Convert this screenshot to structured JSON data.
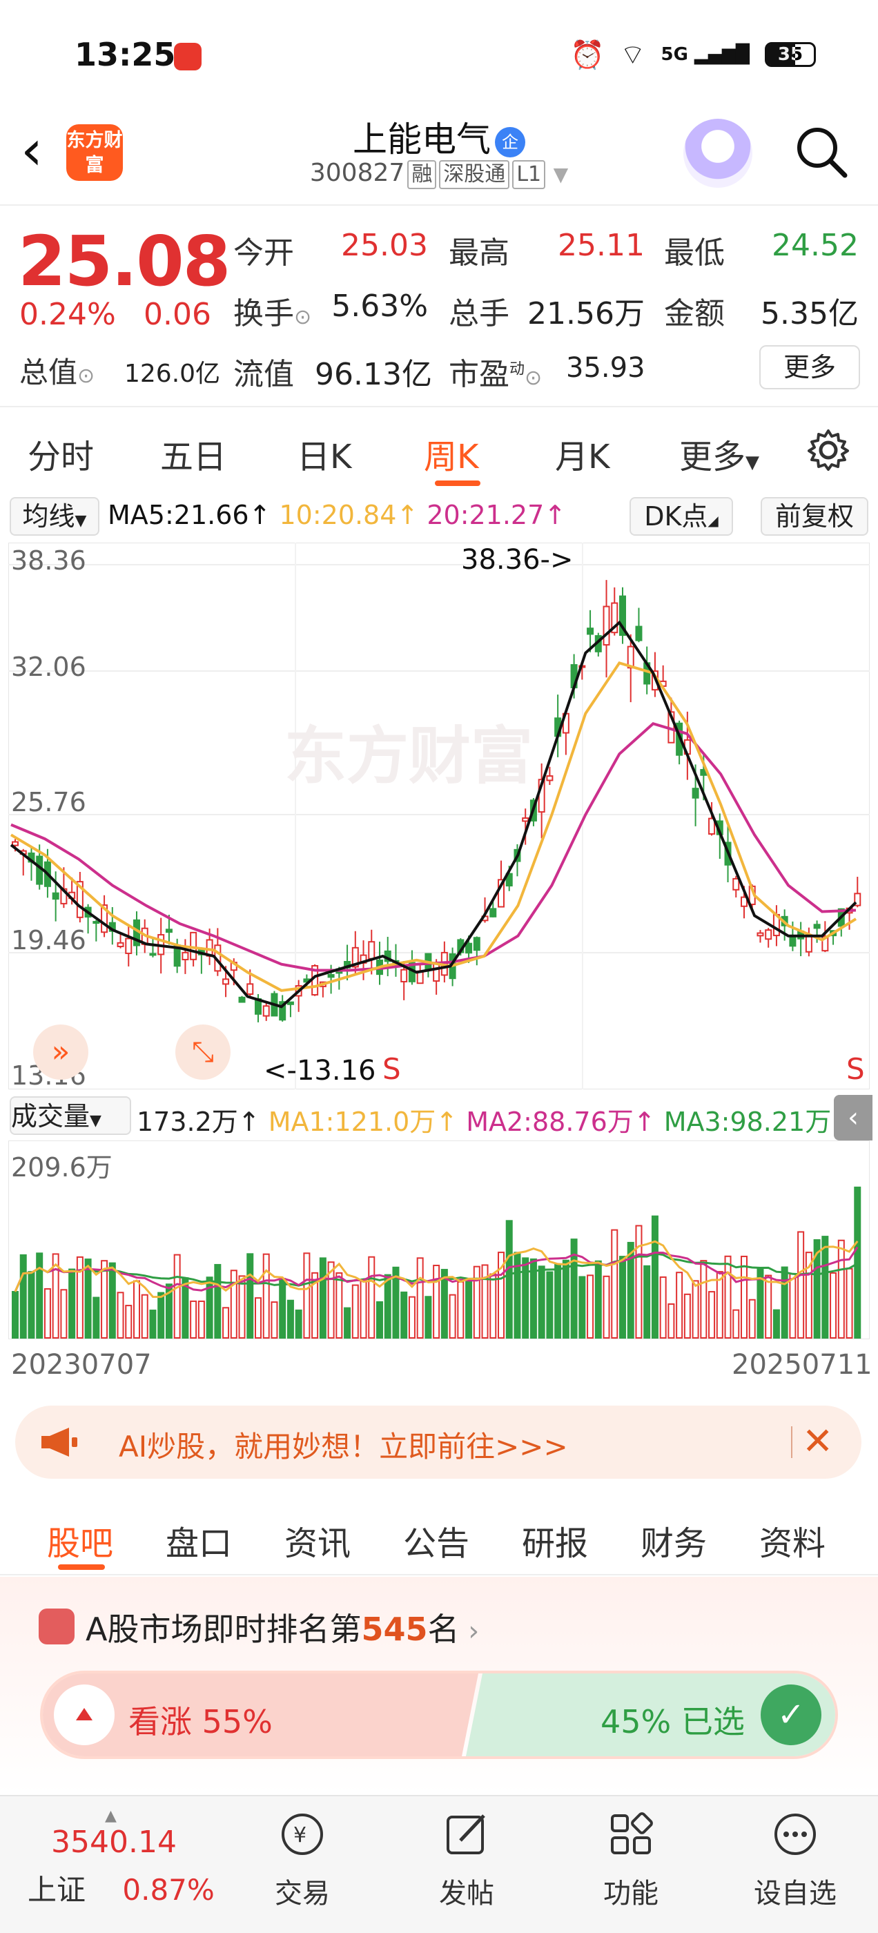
{
  "status_bar": {
    "time": "13:25",
    "signal": "5G",
    "battery": "35"
  },
  "header": {
    "app_logo": "东方财富",
    "stock_name": "上能电气",
    "badge": "企",
    "code": "300827",
    "tags": [
      "融",
      "深股通",
      "L1"
    ]
  },
  "quote": {
    "price": "25.08",
    "change_pct": "0.24%",
    "change_abs": "0.06",
    "open_label": "今开",
    "open": "25.03",
    "high_label": "最高",
    "high": "25.11",
    "low_label": "最低",
    "low": "24.52",
    "turnover_label": "换手",
    "turnover": "5.63%",
    "volume_label": "总手",
    "volume": "21.56万",
    "amount_label": "金额",
    "amount": "5.35亿",
    "mktcap_label": "总值",
    "mktcap": "126.0亿",
    "float_label": "流值",
    "float": "96.13亿",
    "pe_label": "市盈",
    "pe_sup": "动",
    "pe": "35.93",
    "more": "更多"
  },
  "period_tabs": [
    "分时",
    "五日",
    "日K",
    "周K",
    "月K",
    "更多"
  ],
  "active_period": "周K",
  "chart_toolbar": {
    "indicator": "均线",
    "ma5": "MA5:21.66",
    "ma10": "10:20.84",
    "ma20": "20:21.27",
    "dk": "DK点",
    "adjust": "前复权"
  },
  "price_axis": [
    "38.36",
    "32.06",
    "25.76",
    "19.46",
    "13.16"
  ],
  "annotations": {
    "high_marker": "38.36->",
    "low_marker": "<-13.16",
    "sell": "S"
  },
  "watermark": "东方财富",
  "volume_toolbar": {
    "indicator": "成交量",
    "vol": "173.2万",
    "ma1": "MA1:121.0万",
    "ma2": "MA2:88.76万",
    "ma3": "MA3:98.21万",
    "max": "209.6万"
  },
  "date_axis": {
    "start": "20230707",
    "end": "20250711"
  },
  "colors": {
    "up": "#e03131",
    "down": "#2f9e44",
    "ma5": "#111111",
    "ma10": "#f2b63c",
    "ma20": "#cc2f8c",
    "accent": "#ff5a1f"
  },
  "chart_data": {
    "type": "candlestick",
    "x_range": [
      "20230707",
      "20250711"
    ],
    "ylim": [
      13.16,
      38.36
    ],
    "series": [
      {
        "name": "MA5",
        "values": [
          24.5,
          23.2,
          21.5,
          20.3,
          19.6,
          19.4,
          19.0,
          17.0,
          16.5,
          18.0,
          18.5,
          19.0,
          18.2,
          18.5,
          21.0,
          24.0,
          29.0,
          34.0,
          35.5,
          33.0,
          29.0,
          25.0,
          21.0,
          20.0,
          20.0,
          21.66
        ]
      },
      {
        "name": "MA10",
        "values": [
          25.0,
          24.0,
          22.5,
          21.0,
          20.0,
          19.5,
          19.3,
          18.2,
          17.3,
          17.5,
          18.0,
          18.5,
          18.8,
          18.5,
          19.0,
          21.5,
          26.0,
          31.0,
          33.5,
          33.0,
          30.5,
          26.5,
          22.0,
          20.5,
          19.8,
          20.84
        ]
      },
      {
        "name": "MA20",
        "values": [
          25.5,
          24.8,
          23.8,
          22.5,
          21.5,
          20.6,
          20.0,
          19.3,
          18.6,
          18.3,
          18.3,
          18.4,
          18.6,
          18.7,
          19.0,
          20.0,
          22.5,
          26.0,
          29.0,
          30.5,
          30.0,
          28.0,
          25.0,
          22.5,
          21.2,
          21.27
        ]
      }
    ],
    "volume": {
      "ylim": [
        0,
        209.6
      ],
      "unit": "万",
      "series": [
        {
          "name": "MA1",
          "last": 121.0
        },
        {
          "name": "MA2",
          "last": 88.76
        },
        {
          "name": "MA3",
          "last": 98.21
        }
      ],
      "last": 173.2
    }
  },
  "ai_banner": {
    "text": "AI炒股，就用妙想！立即前往>>>"
  },
  "info_tabs": [
    "股吧",
    "盘口",
    "资讯",
    "公告",
    "研报",
    "财务",
    "资料"
  ],
  "active_info_tab": "股吧",
  "ranking": {
    "prefix": "A股市场即时排名第",
    "rank": "545",
    "suffix": "名"
  },
  "vote": {
    "up_label": "看涨 55%",
    "up_pct": 55,
    "down_label": "45% 已选",
    "down_pct": 45
  },
  "bottom_nav": {
    "index_value": "3540.14",
    "index_name": "上证",
    "index_change": "0.87%",
    "items": [
      "交易",
      "发帖",
      "功能",
      "设自选"
    ]
  }
}
